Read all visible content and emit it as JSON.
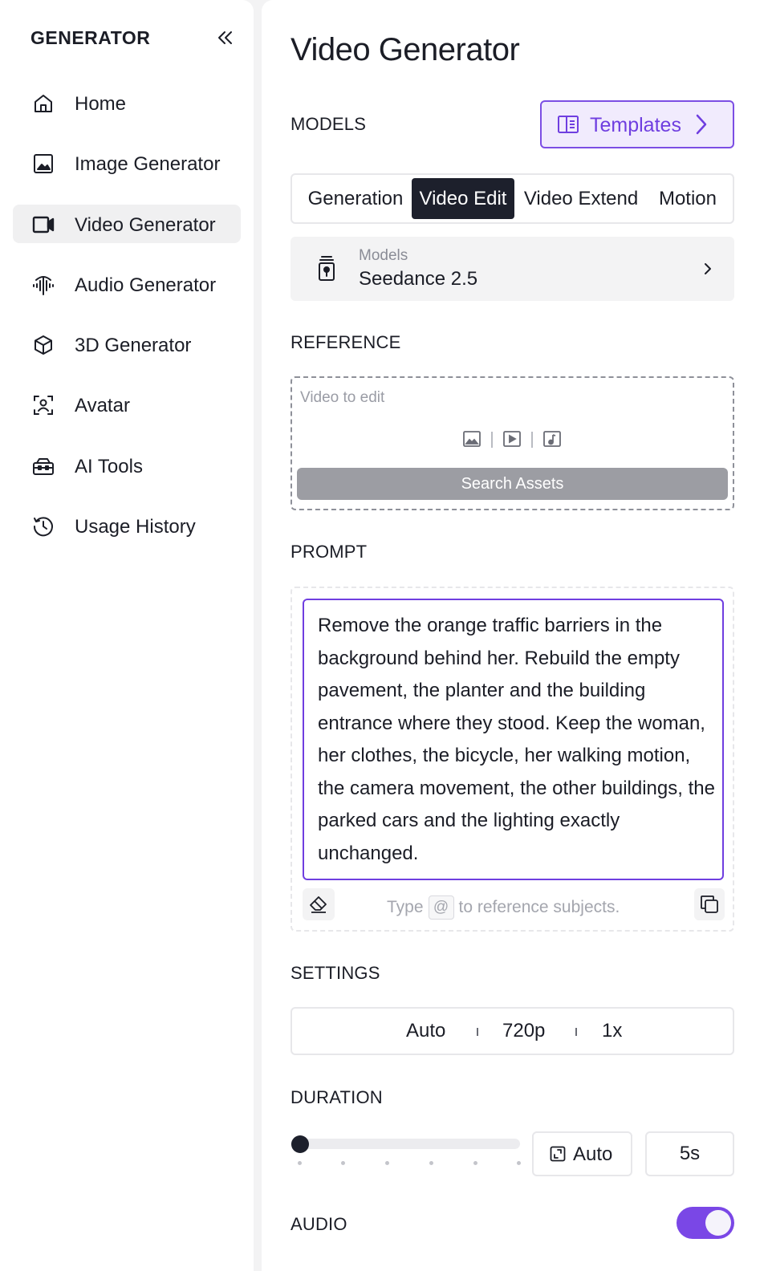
{
  "sidebar": {
    "heading": "GENERATOR",
    "items": [
      {
        "label": "Home",
        "icon": "home-icon"
      },
      {
        "label": "Image Generator",
        "icon": "image-icon"
      },
      {
        "label": "Video Generator",
        "icon": "video-camera-icon",
        "active": true
      },
      {
        "label": "Audio Generator",
        "icon": "audio-wave-icon"
      },
      {
        "label": "3D Generator",
        "icon": "cube-icon"
      },
      {
        "label": "Avatar",
        "icon": "avatar-scan-icon"
      },
      {
        "label": "AI Tools",
        "icon": "toolbox-icon"
      },
      {
        "label": "Usage History",
        "icon": "history-icon"
      }
    ]
  },
  "main": {
    "title": "Video Generator",
    "models_label": "MODELS",
    "templates_label": "Templates",
    "tabs": [
      {
        "label": "Generation"
      },
      {
        "label": "Video Edit",
        "active": true
      },
      {
        "label": "Video Extend"
      },
      {
        "label": "Motion"
      }
    ],
    "model_selector": {
      "caption": "Models",
      "value": "Seedance 2.5"
    },
    "reference_label": "REFERENCE",
    "reference": {
      "caption": "Video to edit",
      "search_label": "Search Assets"
    },
    "prompt_label": "PROMPT",
    "prompt": {
      "text": "Remove the orange traffic barriers in the background behind her. Rebuild the empty pavement, the planter and the building entrance where they stood. Keep the woman, her clothes, the bicycle, her walking motion, the camera movement, the other buildings, the parked cars and the lighting exactly unchanged.",
      "hint_before": "Type",
      "hint_key": "@",
      "hint_after": "to reference subjects."
    },
    "settings_label": "SETTINGS",
    "settings": {
      "aspect": "Auto",
      "resolution": "720p",
      "count": "1x"
    },
    "duration_label": "DURATION",
    "duration": {
      "auto_label": "Auto",
      "value": "5s",
      "slider_position": 0
    },
    "audio_label": "AUDIO",
    "audio_enabled": true
  },
  "colors": {
    "accent": "#7c4ee4",
    "accent_text": "#6f3ee0",
    "dark": "#1d202c",
    "background": "#f3f3f4"
  }
}
